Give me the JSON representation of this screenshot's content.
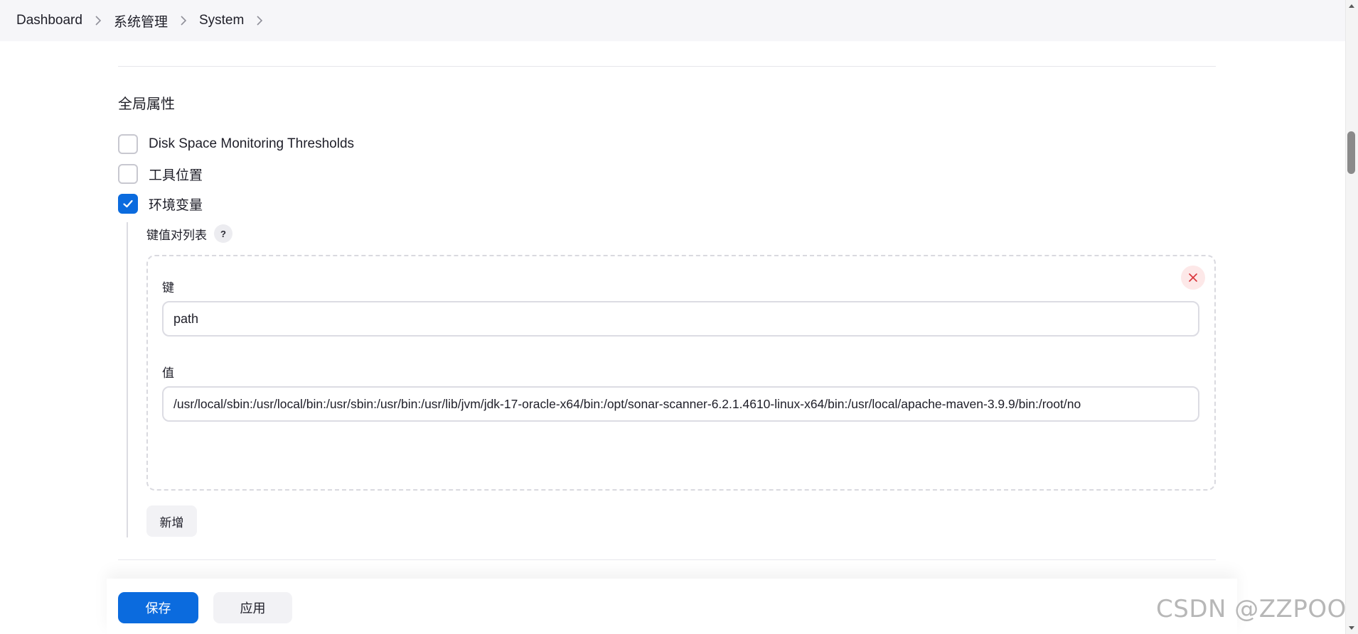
{
  "breadcrumb": {
    "items": [
      "Dashboard",
      "系统管理",
      "System"
    ]
  },
  "section": {
    "title": "全局属性"
  },
  "options": [
    {
      "label": "Disk Space Monitoring Thresholds",
      "checked": false
    },
    {
      "label": "工具位置",
      "checked": false
    },
    {
      "label": "环境变量",
      "checked": true
    }
  ],
  "env_vars": {
    "list_label": "键值对列表",
    "help_symbol": "?",
    "entry": {
      "key_label": "键",
      "key_value": "path",
      "value_label": "值",
      "value_value": "/usr/local/sbin:/usr/local/bin:/usr/sbin:/usr/bin:/usr/lib/jvm/jdk-17-oracle-x64/bin:/opt/sonar-scanner-6.2.1.4610-linux-x64/bin:/usr/local/apache-maven-3.9.9/bin:/root/no"
    },
    "add_label": "新增"
  },
  "footer": {
    "save_label": "保存",
    "apply_label": "应用"
  },
  "watermark": "CSDN @ZZPOOM",
  "colors": {
    "primary": "#0b6bde",
    "delete_bg": "#fde8e8",
    "delete_icon": "#d9343a"
  }
}
